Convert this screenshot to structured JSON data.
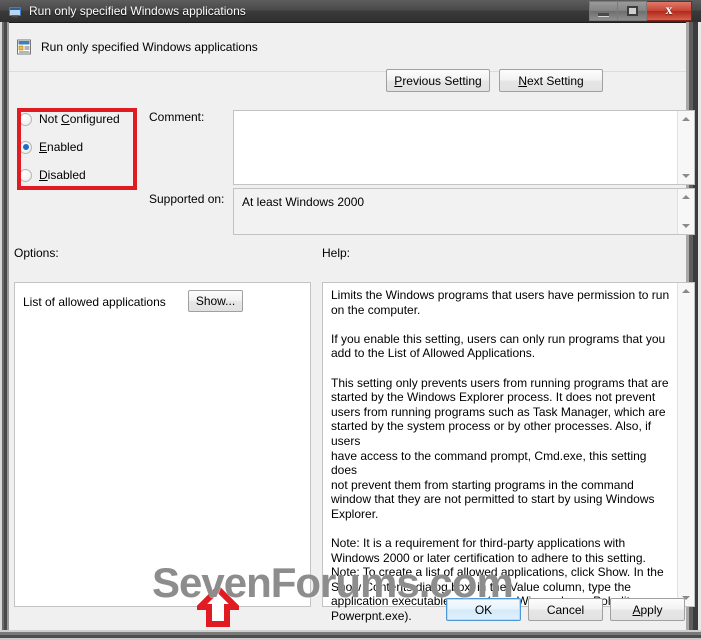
{
  "window": {
    "title": "Run only specified Windows applications",
    "icon": "policy-window-icon",
    "buttons": {
      "minimize": "minimize-icon",
      "maximize": "maximize-icon",
      "close": "x"
    }
  },
  "header": {
    "icon": "policy-setting-icon",
    "title": "Run only specified Windows applications",
    "previous_setting_pre": "P",
    "previous_setting_post": "revious Setting",
    "next_setting_pre": "N",
    "next_setting_post": "ext Setting"
  },
  "state_options": {
    "selected": "Enabled",
    "items": [
      {
        "label_pre": "Not ",
        "label_accel": "C",
        "label_post": "onfigured",
        "checked": false,
        "name": "not-configured"
      },
      {
        "label_pre": "",
        "label_accel": "E",
        "label_post": "nabled",
        "checked": true,
        "name": "enabled"
      },
      {
        "label_pre": "",
        "label_accel": "D",
        "label_post": "isabled",
        "checked": false,
        "name": "disabled"
      }
    ]
  },
  "comment": {
    "label": "Comment:",
    "value": "",
    "placeholder": ""
  },
  "supported_on": {
    "label": "Supported on:",
    "value": "At least Windows 2000"
  },
  "sections": {
    "options_label": "Options:",
    "help_label": "Help:"
  },
  "options": {
    "list_label": "List of allowed applications",
    "show_button": "Show..."
  },
  "help": {
    "text": "Limits the Windows programs that users have permission to run\non the computer.\n\nIf you enable this setting, users can only run programs that you\nadd to the List of Allowed Applications.\n\nThis setting only prevents users from running programs that are\nstarted by the Windows Explorer process. It does not prevent\nusers from running programs such as Task Manager, which are\nstarted by the system process or by other processes. Also, if users\nhave access to the command prompt, Cmd.exe, this setting does\nnot prevent them from starting programs in the command\nwindow that they are not permitted to start by using Windows\nExplorer.\n\nNote: It is a requirement for third-party applications with\nWindows 2000 or later certification to adhere to this setting.\nNote: To create a list of allowed applications, click Show. In the\nShow Contents dialog box, in the Value column, type the\napplication executable name (e.g., Winword.exe, Poledit.exe,\nPowerpnt.exe)."
  },
  "footer": {
    "ok": "OK",
    "cancel": "Cancel",
    "apply_accel": "A",
    "apply_post": "pply"
  },
  "watermark": {
    "text": "SevenForums.com"
  },
  "annotations": {
    "state_highlight_color": "#e11b22",
    "arrow_color": "#e11b22"
  }
}
